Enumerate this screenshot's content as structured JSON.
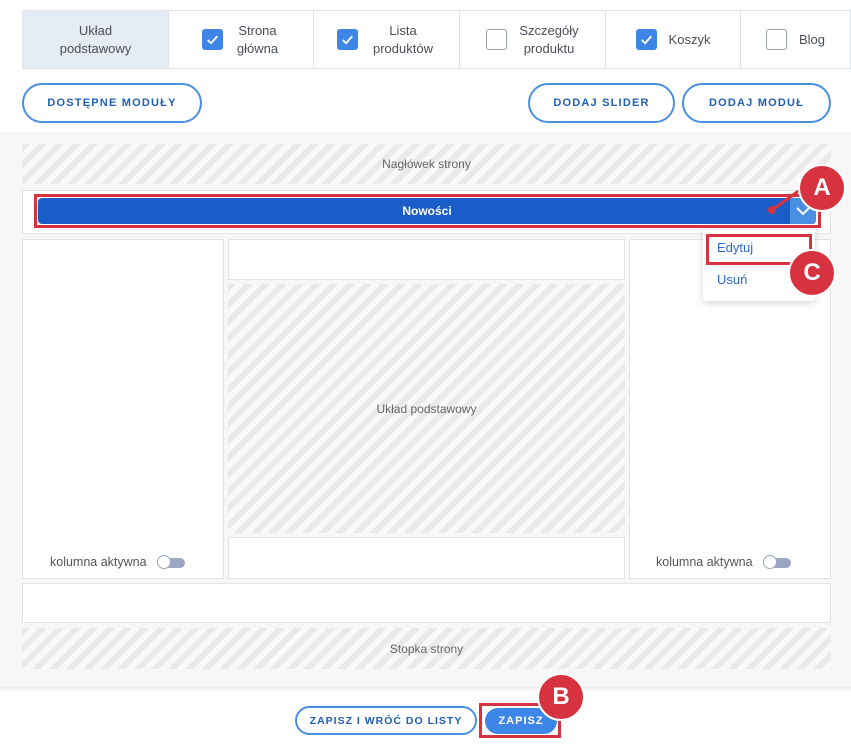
{
  "tabs": [
    {
      "label": "Układ podstawowy",
      "checked": null
    },
    {
      "label": "Strona główna",
      "checked": true
    },
    {
      "label": "Lista produktów",
      "checked": true
    },
    {
      "label": "Szczegóły produktu",
      "checked": false
    },
    {
      "label": "Koszyk",
      "checked": true
    },
    {
      "label": "Blog",
      "checked": false
    }
  ],
  "toolbar": {
    "available_modules": "DOSTĘPNE MODUŁY",
    "add_slider": "DODAJ SLIDER",
    "add_module": "DODAJ MODUŁ"
  },
  "layout": {
    "header": "Nagłówek strony",
    "module_name": "Nowości",
    "main_area": "Układ podstawowy",
    "footer": "Stopka strony",
    "left_column_active": "kolumna aktywna",
    "right_column_active": "kolumna aktywna"
  },
  "dropdown": {
    "edit": "Edytuj",
    "delete": "Usuń"
  },
  "annotations": {
    "a": "A",
    "b": "B",
    "c": "C"
  },
  "footer_actions": {
    "save_and_back": "ZAPISZ I WRÓĆ DO LISTY",
    "save": "ZAPISZ"
  },
  "colors": {
    "accent": "#3d86e8",
    "module_bar": "#1a5cc8",
    "annotation": "#d7323f"
  }
}
